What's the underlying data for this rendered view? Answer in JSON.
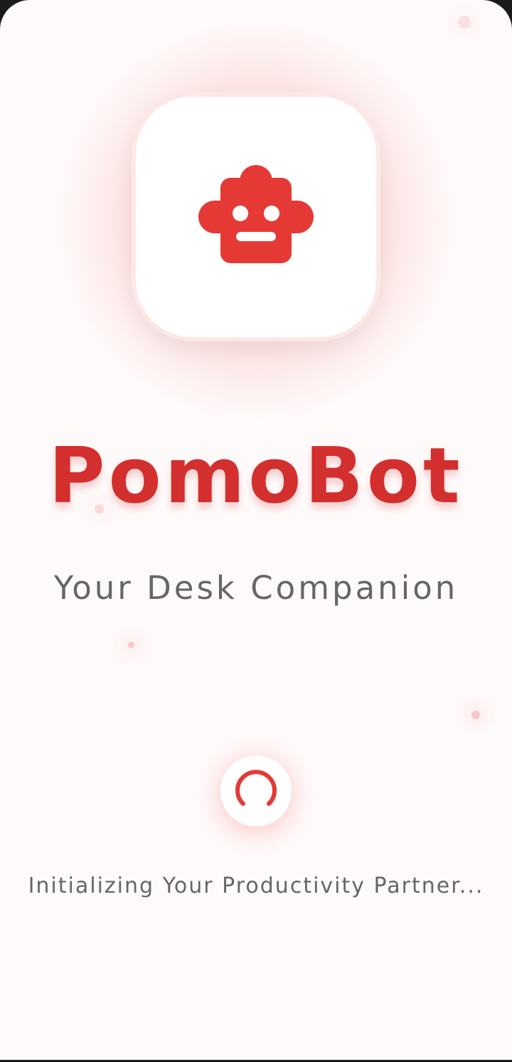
{
  "app": {
    "name": "PomoBot",
    "tagline": "Your Desk Companion",
    "status": "Initializing Your Productivity Partner..."
  },
  "icons": {
    "logo": "robot-icon",
    "loader": "loading-spinner"
  },
  "colors": {
    "accent": "#e53935",
    "title": "#d32f2f",
    "text_muted": "#666666",
    "background": "#fffafa"
  },
  "loading": {
    "indeterminate": true
  }
}
